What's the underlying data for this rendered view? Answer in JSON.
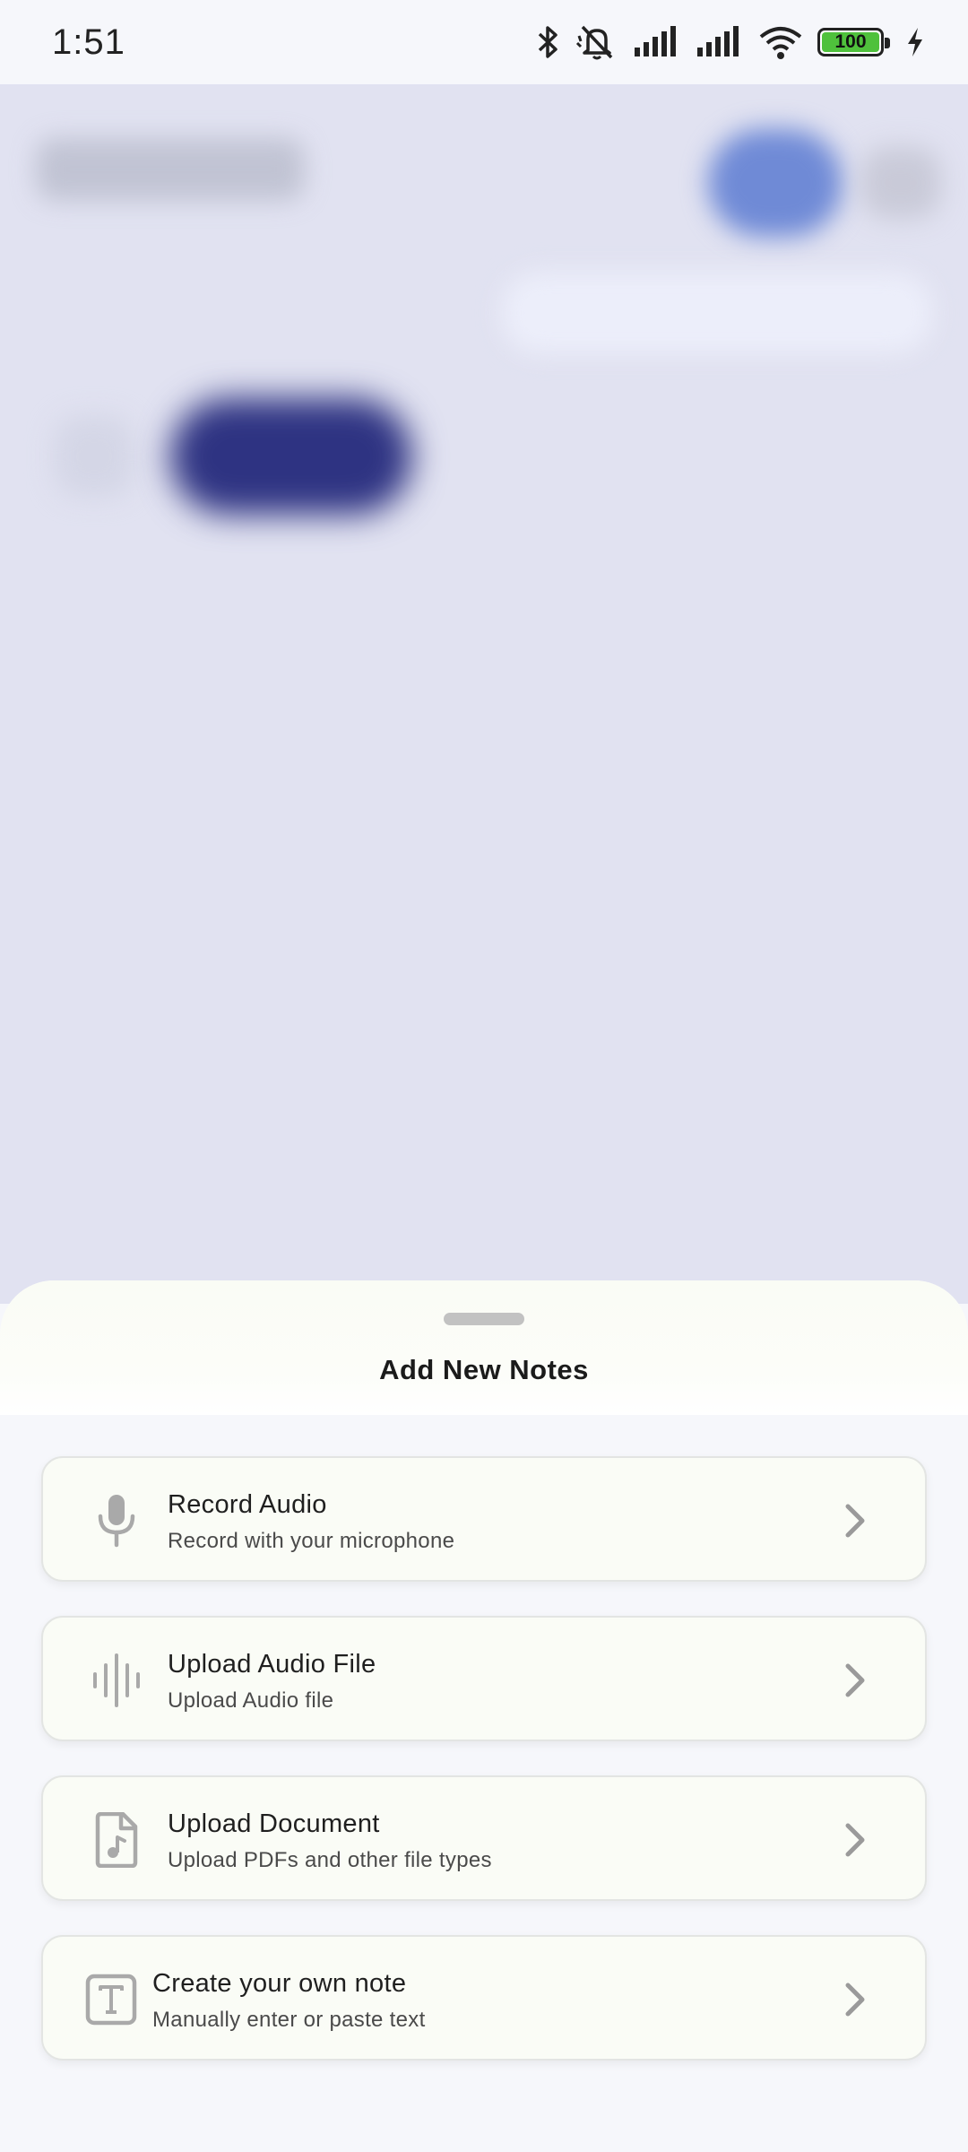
{
  "status_bar": {
    "time": "1:51",
    "battery_level": "100",
    "icons": [
      "bluetooth-icon",
      "silent-icon",
      "signal-icon",
      "signal-icon",
      "wifi-icon",
      "battery-icon",
      "charging-icon"
    ]
  },
  "sheet": {
    "title": "Add New Notes",
    "options": [
      {
        "title": "Record Audio",
        "subtitle": "Record with your microphone",
        "icon": "microphone-icon"
      },
      {
        "title": "Upload Audio File",
        "subtitle": "Upload Audio file",
        "icon": "audio-waveform-icon"
      },
      {
        "title": "Upload Document",
        "subtitle": "Upload PDFs and other file types",
        "icon": "document-icon"
      },
      {
        "title": "Create your own note",
        "subtitle": "Manually enter or paste text",
        "icon": "text-icon"
      }
    ]
  },
  "colors": {
    "sheet_background": "#f6f7fb",
    "card_background": "#fafcf6",
    "icon_gray": "#a9a9a9",
    "chevron_gray": "#9a9a9a",
    "backdrop": "#e1e2f1"
  }
}
